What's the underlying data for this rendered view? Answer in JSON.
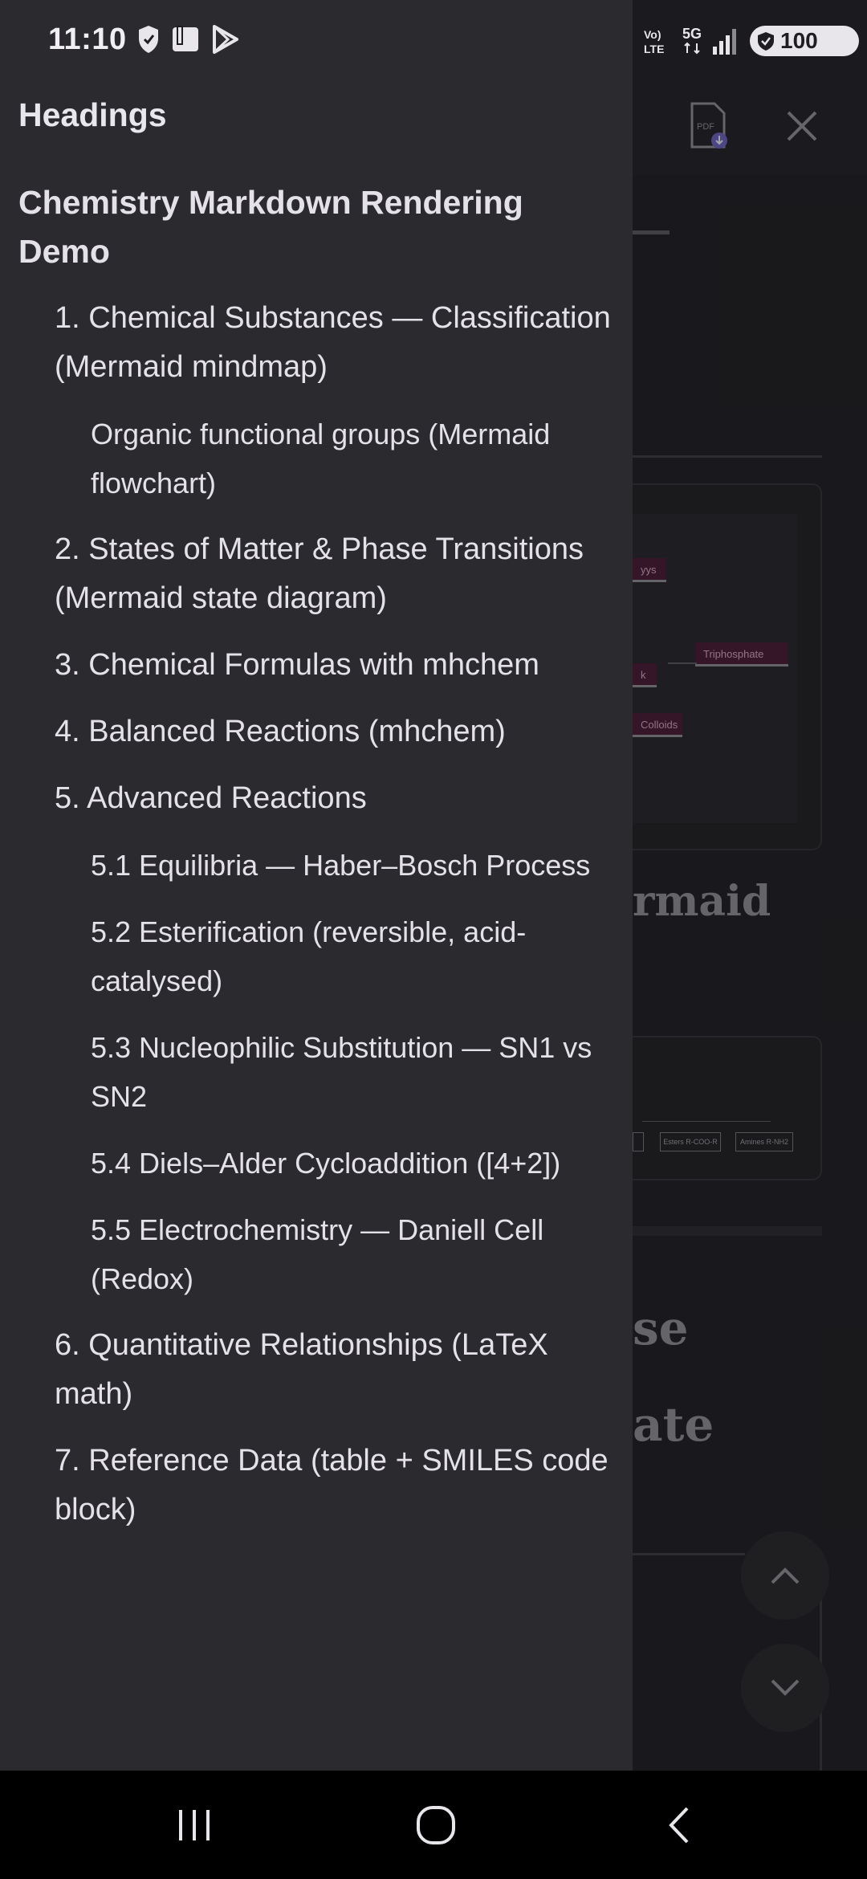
{
  "status_bar": {
    "time": "11:10",
    "network_label": "Vo) LTE",
    "network_type": "5G",
    "battery": "100",
    "icons": [
      "shield-icon",
      "clipboard-icon",
      "play-store-icon",
      "signal-icon",
      "battery-icon"
    ]
  },
  "background": {
    "heading_a": "rmaid",
    "heading_b": "se",
    "heading_c": "ate",
    "node_labels": [
      "yys",
      "Triphosphate",
      "k",
      "Colloids"
    ],
    "flow_boxes": [
      "",
      "Esters R-COO-R",
      "Amines R-NH2"
    ]
  },
  "drawer": {
    "title": "Headings",
    "items": [
      {
        "label": "Chemistry Markdown Rendering Demo"
      },
      {
        "label": "1. Chemical Substances — Classification (Mermaid mindmap)"
      },
      {
        "label": "Organic functional groups (Mermaid flowchart)"
      },
      {
        "label": "2. States of Matter & Phase Transitions (Mermaid state diagram)"
      },
      {
        "label": "3. Chemical Formulas with mhchem"
      },
      {
        "label": "4. Balanced Reactions (mhchem)"
      },
      {
        "label": "5. Advanced Reactions"
      },
      {
        "label": "5.1 Equilibria — Haber–Bosch Process"
      },
      {
        "label": "5.2 Esterification (reversible, acid-catalysed)"
      },
      {
        "label": "5.3 Nucleophilic Substitution — SN1 vs SN2"
      },
      {
        "label": "5.4 Diels–Alder Cycloaddition ([4+2])"
      },
      {
        "label": "5.5 Electrochemistry — Daniell Cell (Redox)"
      },
      {
        "label": "6. Quantitative Relationships (LaTeX math)"
      },
      {
        "label": "7. Reference Data (table + SMILES code block)"
      }
    ]
  },
  "toolbar": {
    "pdf_label": "PDF"
  },
  "colors": {
    "drawer_bg": "#2b2a2f",
    "page_bg": "#1e1d21",
    "text": "#e4e2e8",
    "node_fill": "#4a1f3a"
  }
}
